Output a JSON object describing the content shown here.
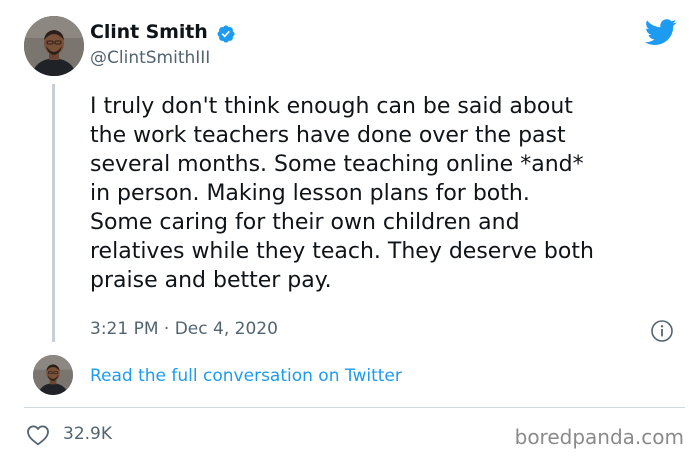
{
  "author": {
    "name": "Clint Smith",
    "handle": "@ClintSmithIII",
    "verified": true
  },
  "tweet": {
    "text": "I truly don't think enough can be said about\nthe work teachers have done over the past\nseveral months. Some teaching online *and*\nin person. Making lesson plans for both.\nSome caring for their own children and\nrelatives while they teach. They deserve both\npraise and better pay.",
    "timestamp": "3:21 PM · Dec 4, 2020"
  },
  "conversation": {
    "link_label": "Read the full conversation on Twitter"
  },
  "engagement": {
    "likes": "32.9K"
  },
  "watermark": "boredpanda.com",
  "icons": {
    "brand": "twitter-bird-icon",
    "verified": "verified-badge-icon",
    "info": "info-icon",
    "like": "heart-icon"
  },
  "colors": {
    "twitter_blue": "#1d9bf0",
    "text_primary": "#0f1419",
    "text_secondary": "#536471",
    "divider": "#cfd9de",
    "thread_line": "#c4cfd6"
  }
}
